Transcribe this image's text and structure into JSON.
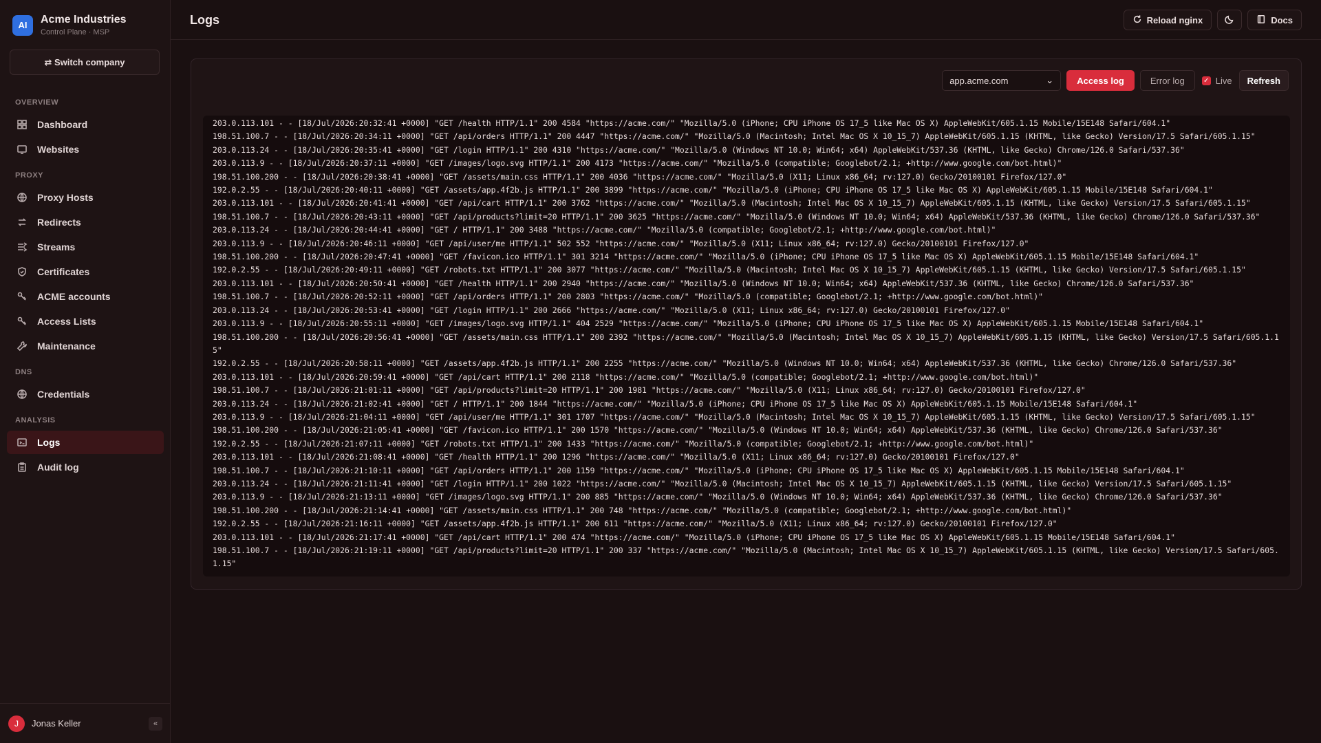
{
  "brand": {
    "logo": "AI",
    "name": "Acme Industries",
    "sub": "Control Plane · MSP"
  },
  "switch_company": "⇄ Switch company",
  "nav": {
    "sections": [
      {
        "title": "OVERVIEW",
        "items": [
          {
            "label": "Dashboard",
            "icon": "dashboard-icon"
          },
          {
            "label": "Websites",
            "icon": "websites-icon"
          }
        ]
      },
      {
        "title": "PROXY",
        "items": [
          {
            "label": "Proxy Hosts",
            "icon": "globe-icon"
          },
          {
            "label": "Redirects",
            "icon": "redirect-icon"
          },
          {
            "label": "Streams",
            "icon": "streams-icon"
          },
          {
            "label": "Certificates",
            "icon": "shield-icon"
          },
          {
            "label": "ACME accounts",
            "icon": "key-icon"
          },
          {
            "label": "Access Lists",
            "icon": "key-icon"
          },
          {
            "label": "Maintenance",
            "icon": "wrench-icon"
          }
        ]
      },
      {
        "title": "DNS",
        "items": [
          {
            "label": "Credentials",
            "icon": "globe-icon"
          }
        ]
      },
      {
        "title": "ANALYSIS",
        "items": [
          {
            "label": "Logs",
            "icon": "terminal-icon"
          },
          {
            "label": "Audit log",
            "icon": "clipboard-icon"
          }
        ]
      }
    ],
    "active": "Logs"
  },
  "user": {
    "initial": "J",
    "name": "Jonas Keller",
    "collapse": "«"
  },
  "topbar": {
    "title": "Logs",
    "reload": "Reload nginx",
    "docs": "Docs"
  },
  "toolbar": {
    "site": "app.acme.com",
    "access_log": "Access log",
    "error_log": "Error log",
    "live": "Live",
    "refresh": "Refresh"
  },
  "log_lines": [
    "203.0.113.101 - - [18/Jul/2026:20:32:41 +0000] \"GET /health HTTP/1.1\" 200 4584 \"https://acme.com/\" \"Mozilla/5.0 (iPhone; CPU iPhone OS 17_5 like Mac OS X) AppleWebKit/605.1.15 Mobile/15E148 Safari/604.1\"",
    "198.51.100.7 - - [18/Jul/2026:20:34:11 +0000] \"GET /api/orders HTTP/1.1\" 200 4447 \"https://acme.com/\" \"Mozilla/5.0 (Macintosh; Intel Mac OS X 10_15_7) AppleWebKit/605.1.15 (KHTML, like Gecko) Version/17.5 Safari/605.1.15\"",
    "203.0.113.24 - - [18/Jul/2026:20:35:41 +0000] \"GET /login HTTP/1.1\" 200 4310 \"https://acme.com/\" \"Mozilla/5.0 (Windows NT 10.0; Win64; x64) AppleWebKit/537.36 (KHTML, like Gecko) Chrome/126.0 Safari/537.36\"",
    "203.0.113.9 - - [18/Jul/2026:20:37:11 +0000] \"GET /images/logo.svg HTTP/1.1\" 200 4173 \"https://acme.com/\" \"Mozilla/5.0 (compatible; Googlebot/2.1; +http://www.google.com/bot.html)\"",
    "198.51.100.200 - - [18/Jul/2026:20:38:41 +0000] \"GET /assets/main.css HTTP/1.1\" 200 4036 \"https://acme.com/\" \"Mozilla/5.0 (X11; Linux x86_64; rv:127.0) Gecko/20100101 Firefox/127.0\"",
    "192.0.2.55 - - [18/Jul/2026:20:40:11 +0000] \"GET /assets/app.4f2b.js HTTP/1.1\" 200 3899 \"https://acme.com/\" \"Mozilla/5.0 (iPhone; CPU iPhone OS 17_5 like Mac OS X) AppleWebKit/605.1.15 Mobile/15E148 Safari/604.1\"",
    "203.0.113.101 - - [18/Jul/2026:20:41:41 +0000] \"GET /api/cart HTTP/1.1\" 200 3762 \"https://acme.com/\" \"Mozilla/5.0 (Macintosh; Intel Mac OS X 10_15_7) AppleWebKit/605.1.15 (KHTML, like Gecko) Version/17.5 Safari/605.1.15\"",
    "198.51.100.7 - - [18/Jul/2026:20:43:11 +0000] \"GET /api/products?limit=20 HTTP/1.1\" 200 3625 \"https://acme.com/\" \"Mozilla/5.0 (Windows NT 10.0; Win64; x64) AppleWebKit/537.36 (KHTML, like Gecko) Chrome/126.0 Safari/537.36\"",
    "203.0.113.24 - - [18/Jul/2026:20:44:41 +0000] \"GET / HTTP/1.1\" 200 3488 \"https://acme.com/\" \"Mozilla/5.0 (compatible; Googlebot/2.1; +http://www.google.com/bot.html)\"",
    "203.0.113.9 - - [18/Jul/2026:20:46:11 +0000] \"GET /api/user/me HTTP/1.1\" 502 552 \"https://acme.com/\" \"Mozilla/5.0 (X11; Linux x86_64; rv:127.0) Gecko/20100101 Firefox/127.0\"",
    "198.51.100.200 - - [18/Jul/2026:20:47:41 +0000] \"GET /favicon.ico HTTP/1.1\" 301 3214 \"https://acme.com/\" \"Mozilla/5.0 (iPhone; CPU iPhone OS 17_5 like Mac OS X) AppleWebKit/605.1.15 Mobile/15E148 Safari/604.1\"",
    "192.0.2.55 - - [18/Jul/2026:20:49:11 +0000] \"GET /robots.txt HTTP/1.1\" 200 3077 \"https://acme.com/\" \"Mozilla/5.0 (Macintosh; Intel Mac OS X 10_15_7) AppleWebKit/605.1.15 (KHTML, like Gecko) Version/17.5 Safari/605.1.15\"",
    "203.0.113.101 - - [18/Jul/2026:20:50:41 +0000] \"GET /health HTTP/1.1\" 200 2940 \"https://acme.com/\" \"Mozilla/5.0 (Windows NT 10.0; Win64; x64) AppleWebKit/537.36 (KHTML, like Gecko) Chrome/126.0 Safari/537.36\"",
    "198.51.100.7 - - [18/Jul/2026:20:52:11 +0000] \"GET /api/orders HTTP/1.1\" 200 2803 \"https://acme.com/\" \"Mozilla/5.0 (compatible; Googlebot/2.1; +http://www.google.com/bot.html)\"",
    "203.0.113.24 - - [18/Jul/2026:20:53:41 +0000] \"GET /login HTTP/1.1\" 200 2666 \"https://acme.com/\" \"Mozilla/5.0 (X11; Linux x86_64; rv:127.0) Gecko/20100101 Firefox/127.0\"",
    "203.0.113.9 - - [18/Jul/2026:20:55:11 +0000] \"GET /images/logo.svg HTTP/1.1\" 404 2529 \"https://acme.com/\" \"Mozilla/5.0 (iPhone; CPU iPhone OS 17_5 like Mac OS X) AppleWebKit/605.1.15 Mobile/15E148 Safari/604.1\"",
    "198.51.100.200 - - [18/Jul/2026:20:56:41 +0000] \"GET /assets/main.css HTTP/1.1\" 200 2392 \"https://acme.com/\" \"Mozilla/5.0 (Macintosh; Intel Mac OS X 10_15_7) AppleWebKit/605.1.15 (KHTML, like Gecko) Version/17.5 Safari/605.1.15\"",
    "192.0.2.55 - - [18/Jul/2026:20:58:11 +0000] \"GET /assets/app.4f2b.js HTTP/1.1\" 200 2255 \"https://acme.com/\" \"Mozilla/5.0 (Windows NT 10.0; Win64; x64) AppleWebKit/537.36 (KHTML, like Gecko) Chrome/126.0 Safari/537.36\"",
    "203.0.113.101 - - [18/Jul/2026:20:59:41 +0000] \"GET /api/cart HTTP/1.1\" 200 2118 \"https://acme.com/\" \"Mozilla/5.0 (compatible; Googlebot/2.1; +http://www.google.com/bot.html)\"",
    "198.51.100.7 - - [18/Jul/2026:21:01:11 +0000] \"GET /api/products?limit=20 HTTP/1.1\" 200 1981 \"https://acme.com/\" \"Mozilla/5.0 (X11; Linux x86_64; rv:127.0) Gecko/20100101 Firefox/127.0\"",
    "203.0.113.24 - - [18/Jul/2026:21:02:41 +0000] \"GET / HTTP/1.1\" 200 1844 \"https://acme.com/\" \"Mozilla/5.0 (iPhone; CPU iPhone OS 17_5 like Mac OS X) AppleWebKit/605.1.15 Mobile/15E148 Safari/604.1\"",
    "203.0.113.9 - - [18/Jul/2026:21:04:11 +0000] \"GET /api/user/me HTTP/1.1\" 301 1707 \"https://acme.com/\" \"Mozilla/5.0 (Macintosh; Intel Mac OS X 10_15_7) AppleWebKit/605.1.15 (KHTML, like Gecko) Version/17.5 Safari/605.1.15\"",
    "198.51.100.200 - - [18/Jul/2026:21:05:41 +0000] \"GET /favicon.ico HTTP/1.1\" 200 1570 \"https://acme.com/\" \"Mozilla/5.0 (Windows NT 10.0; Win64; x64) AppleWebKit/537.36 (KHTML, like Gecko) Chrome/126.0 Safari/537.36\"",
    "192.0.2.55 - - [18/Jul/2026:21:07:11 +0000] \"GET /robots.txt HTTP/1.1\" 200 1433 \"https://acme.com/\" \"Mozilla/5.0 (compatible; Googlebot/2.1; +http://www.google.com/bot.html)\"",
    "203.0.113.101 - - [18/Jul/2026:21:08:41 +0000] \"GET /health HTTP/1.1\" 200 1296 \"https://acme.com/\" \"Mozilla/5.0 (X11; Linux x86_64; rv:127.0) Gecko/20100101 Firefox/127.0\"",
    "198.51.100.7 - - [18/Jul/2026:21:10:11 +0000] \"GET /api/orders HTTP/1.1\" 200 1159 \"https://acme.com/\" \"Mozilla/5.0 (iPhone; CPU iPhone OS 17_5 like Mac OS X) AppleWebKit/605.1.15 Mobile/15E148 Safari/604.1\"",
    "203.0.113.24 - - [18/Jul/2026:21:11:41 +0000] \"GET /login HTTP/1.1\" 200 1022 \"https://acme.com/\" \"Mozilla/5.0 (Macintosh; Intel Mac OS X 10_15_7) AppleWebKit/605.1.15 (KHTML, like Gecko) Version/17.5 Safari/605.1.15\"",
    "203.0.113.9 - - [18/Jul/2026:21:13:11 +0000] \"GET /images/logo.svg HTTP/1.1\" 200 885 \"https://acme.com/\" \"Mozilla/5.0 (Windows NT 10.0; Win64; x64) AppleWebKit/537.36 (KHTML, like Gecko) Chrome/126.0 Safari/537.36\"",
    "198.51.100.200 - - [18/Jul/2026:21:14:41 +0000] \"GET /assets/main.css HTTP/1.1\" 200 748 \"https://acme.com/\" \"Mozilla/5.0 (compatible; Googlebot/2.1; +http://www.google.com/bot.html)\"",
    "192.0.2.55 - - [18/Jul/2026:21:16:11 +0000] \"GET /assets/app.4f2b.js HTTP/1.1\" 200 611 \"https://acme.com/\" \"Mozilla/5.0 (X11; Linux x86_64; rv:127.0) Gecko/20100101 Firefox/127.0\"",
    "203.0.113.101 - - [18/Jul/2026:21:17:41 +0000] \"GET /api/cart HTTP/1.1\" 200 474 \"https://acme.com/\" \"Mozilla/5.0 (iPhone; CPU iPhone OS 17_5 like Mac OS X) AppleWebKit/605.1.15 Mobile/15E148 Safari/604.1\"",
    "198.51.100.7 - - [18/Jul/2026:21:19:11 +0000] \"GET /api/products?limit=20 HTTP/1.1\" 200 337 \"https://acme.com/\" \"Mozilla/5.0 (Macintosh; Intel Mac OS X 10_15_7) AppleWebKit/605.1.15 (KHTML, like Gecko) Version/17.5 Safari/605.1.15\""
  ],
  "colors": {
    "accent": "#d92d3c",
    "brand_logo": "#2f6fe0",
    "background": "#1a1011"
  }
}
